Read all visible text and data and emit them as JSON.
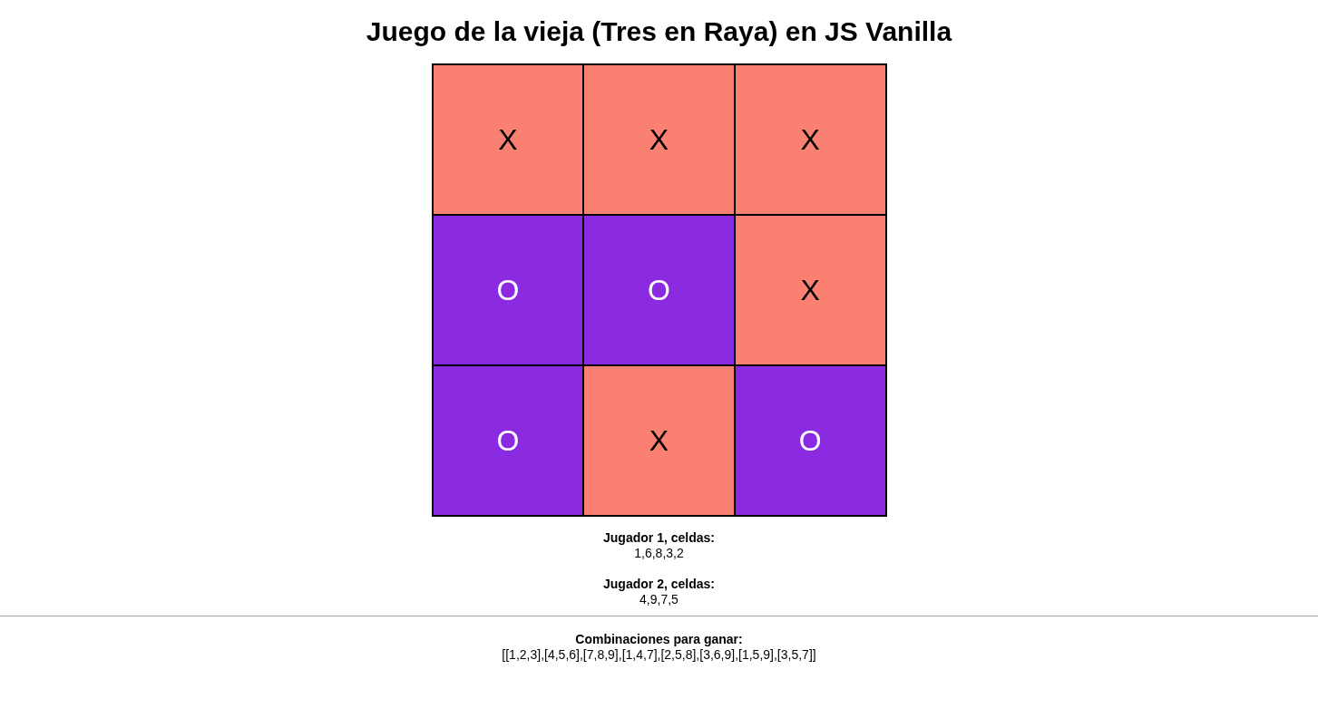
{
  "title": "Juego de la vieja (Tres en Raya) en JS Vanilla",
  "board": [
    {
      "kind": "cross",
      "mark": "X"
    },
    {
      "kind": "cross",
      "mark": "X"
    },
    {
      "kind": "cross",
      "mark": "X"
    },
    {
      "kind": "nought",
      "mark": "O"
    },
    {
      "kind": "nought",
      "mark": "O"
    },
    {
      "kind": "cross",
      "mark": "X"
    },
    {
      "kind": "nought",
      "mark": "O"
    },
    {
      "kind": "cross",
      "mark": "X"
    },
    {
      "kind": "nought",
      "mark": "O"
    }
  ],
  "players": [
    {
      "label": "Jugador 1, celdas:",
      "cells": "1,6,8,3,2"
    },
    {
      "label": "Jugador 2, celdas:",
      "cells": "4,9,7,5"
    }
  ],
  "combinations": {
    "label": "Combinaciones para ganar:",
    "value": "[[1,2,3],[4,5,6],[7,8,9],[1,4,7],[2,5,8],[3,6,9],[1,5,9],[3,5,7]]"
  }
}
